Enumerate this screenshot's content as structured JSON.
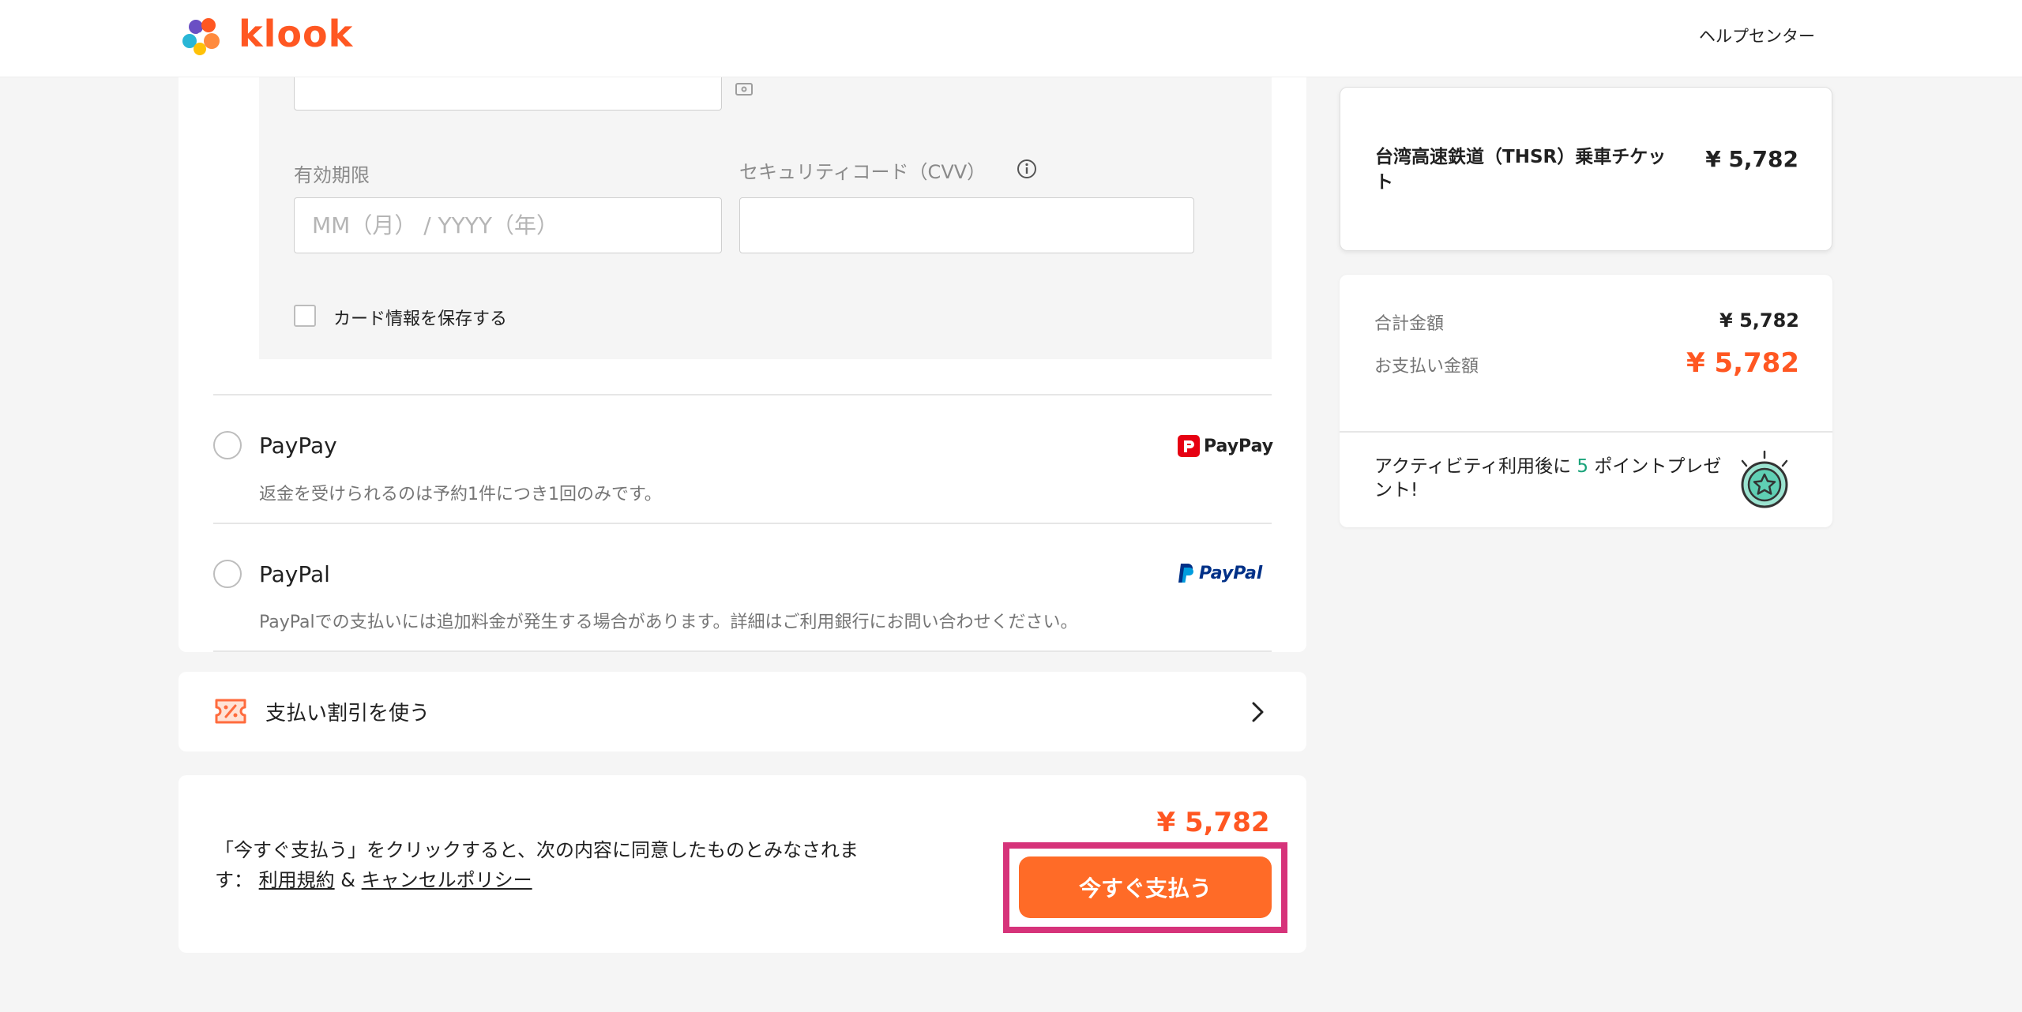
{
  "header": {
    "logo_text": "klook",
    "help_label": "ヘルプセンター"
  },
  "card_form": {
    "expiry_label": "有効期限",
    "expiry_placeholder": "MM（月） / YYYY（年）",
    "cvv_label": "セキュリティコード（CVV）",
    "save_card_label": "カード情報を保存する"
  },
  "payment_methods": [
    {
      "name": "PayPay",
      "description": "返金を受けられるのは予約1件につき1回のみです。",
      "logo_text": "PayPay"
    },
    {
      "name": "PayPal",
      "description": "PayPalでの支払いには追加料金が発生する場合があります。詳細はご利用銀行にお問い合わせください。",
      "logo_text": "PayPal"
    }
  ],
  "discount": {
    "label": "支払い割引を使う"
  },
  "pay": {
    "agree_text": "「今すぐ支払う」をクリックすると、次の内容に同意したものとみなされます：",
    "terms_link": "利用規約",
    "ampersand": "&",
    "cancel_link": "キャンセルポリシー",
    "amount": "¥ 5,782",
    "button_label": "今すぐ支払う"
  },
  "summary": {
    "item_name": "台湾高速鉄道（THSR）乗車チケット",
    "item_price": "¥ 5,782",
    "total_label": "合計金額",
    "total_value": "¥ 5,782",
    "payment_label": "お支払い金額",
    "payment_value": "¥ 5,782",
    "points_prefix": "アクティビティ利用後に",
    "points_number": "5",
    "points_suffix": "ポイントプレゼント!"
  },
  "colors": {
    "brand": "#ff5722",
    "button": "#ff6b27",
    "highlight": "#d6337a",
    "points": "#1aa37a"
  }
}
